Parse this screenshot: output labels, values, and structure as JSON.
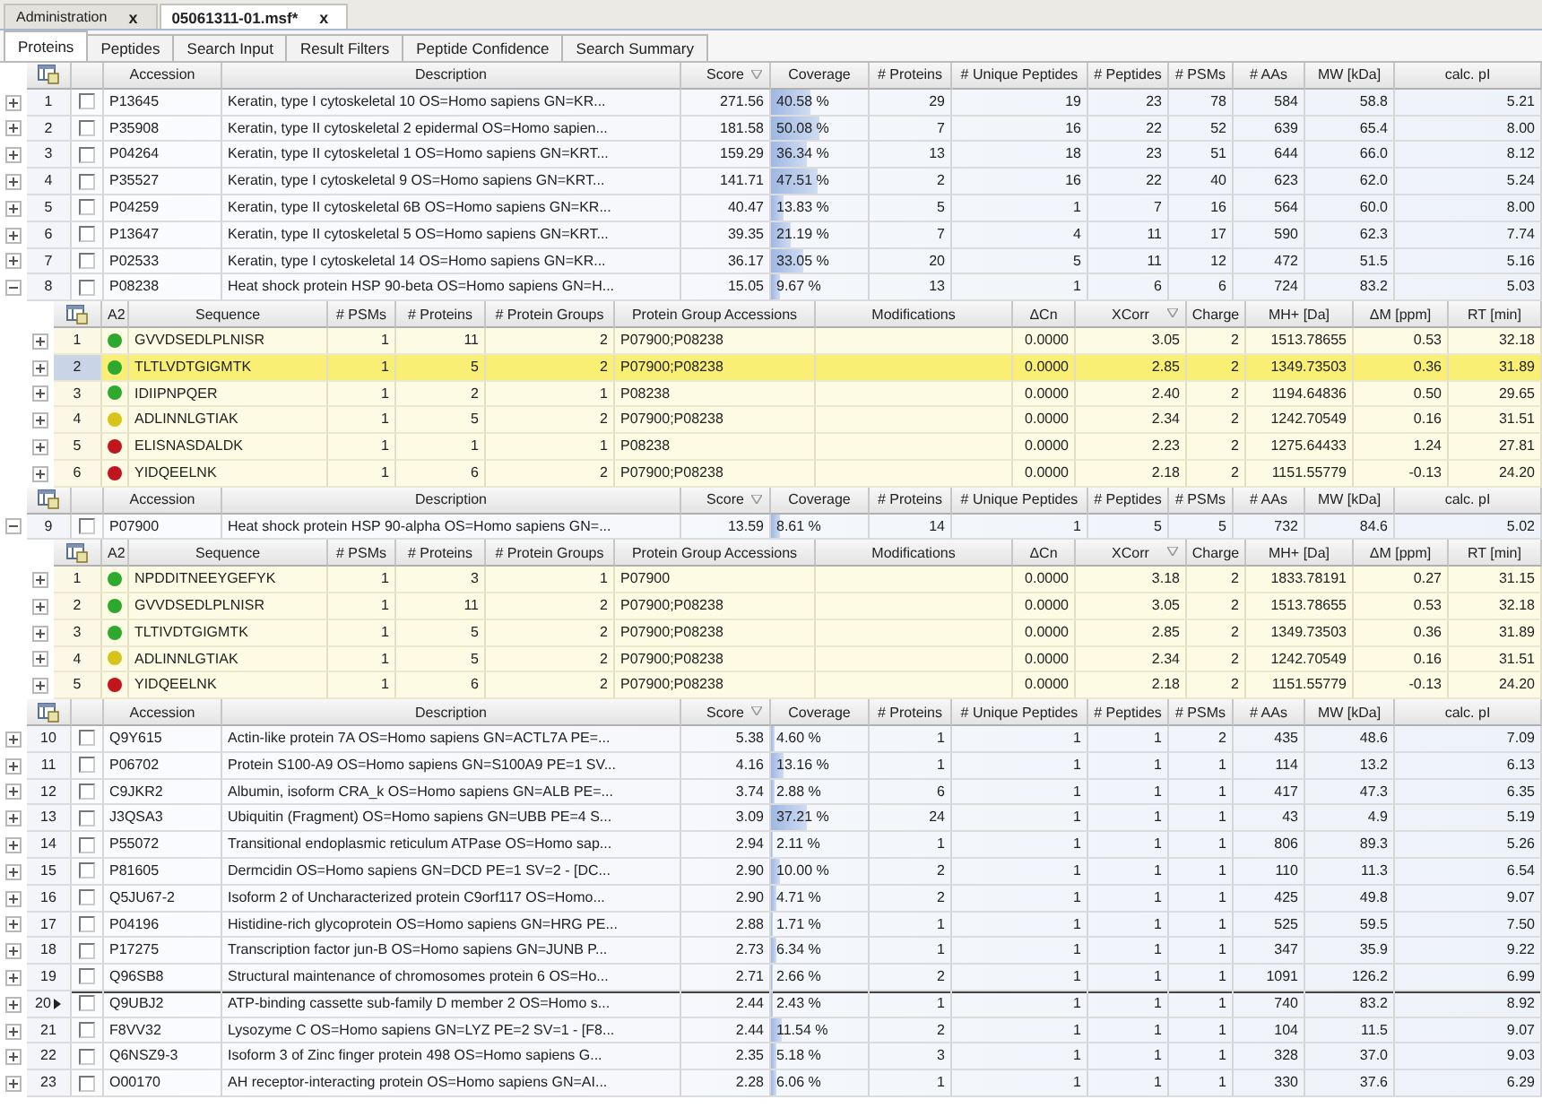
{
  "doc_tabs": [
    {
      "label": "Administration",
      "close": "x",
      "selected": false
    },
    {
      "label": "05061311-01.msf*",
      "close": "x",
      "selected": true
    }
  ],
  "view_tabs": [
    {
      "label": "Proteins",
      "selected": true
    },
    {
      "label": "Peptides",
      "selected": false
    },
    {
      "label": "Search Input",
      "selected": false
    },
    {
      "label": "Result Filters",
      "selected": false
    },
    {
      "label": "Peptide Confidence",
      "selected": false
    },
    {
      "label": "Search Summary",
      "selected": false
    }
  ],
  "sections": [
    {
      "columns": [
        {
          "label": "Accession",
          "sorted": false
        },
        {
          "label": "Description",
          "sorted": false
        },
        {
          "label": "Score",
          "sorted": true
        },
        {
          "label": "Coverage",
          "sorted": false
        },
        {
          "label": "# Proteins",
          "sorted": false
        },
        {
          "label": "# Unique Peptides",
          "sorted": false
        },
        {
          "label": "# Peptides",
          "sorted": false
        },
        {
          "label": "# PSMs",
          "sorted": false
        },
        {
          "label": "# AAs",
          "sorted": false
        },
        {
          "label": "MW [kDa]",
          "sorted": false
        },
        {
          "label": "calc. pI",
          "sorted": false
        }
      ],
      "rows": [
        {
          "n": "1",
          "expanded": false,
          "checked": false,
          "selected": false,
          "accession": "P13645",
          "description": "Keratin, type I cytoskeletal 10 OS=Homo sapiens GN=KR...",
          "score": "271.56",
          "coverage": "40.58 %",
          "level": 0.4058,
          "proteins": "29",
          "unique_peptides": "19",
          "num_peptides": "23",
          "psms": "78",
          "aas": "584",
          "mw": "58.8",
          "pi": "5.21"
        },
        {
          "n": "2",
          "expanded": false,
          "checked": false,
          "selected": false,
          "accession": "P35908",
          "description": "Keratin, type II cytoskeletal 2 epidermal OS=Homo sapien...",
          "score": "181.58",
          "coverage": "50.08 %",
          "level": 0.5008,
          "proteins": "7",
          "unique_peptides": "16",
          "num_peptides": "22",
          "psms": "52",
          "aas": "639",
          "mw": "65.4",
          "pi": "8.00"
        },
        {
          "n": "3",
          "expanded": false,
          "checked": false,
          "selected": false,
          "accession": "P04264",
          "description": "Keratin, type II cytoskeletal 1 OS=Homo sapiens GN=KRT...",
          "score": "159.29",
          "coverage": "36.34 %",
          "level": 0.3634,
          "proteins": "13",
          "unique_peptides": "18",
          "num_peptides": "23",
          "psms": "51",
          "aas": "644",
          "mw": "66.0",
          "pi": "8.12"
        },
        {
          "n": "4",
          "expanded": false,
          "checked": false,
          "selected": false,
          "accession": "P35527",
          "description": "Keratin, type I cytoskeletal 9 OS=Homo sapiens GN=KRT...",
          "score": "141.71",
          "coverage": "47.51 %",
          "level": 0.4751,
          "proteins": "2",
          "unique_peptides": "16",
          "num_peptides": "22",
          "psms": "40",
          "aas": "623",
          "mw": "62.0",
          "pi": "5.24"
        },
        {
          "n": "5",
          "expanded": false,
          "checked": false,
          "selected": false,
          "accession": "P04259",
          "description": "Keratin, type II cytoskeletal 6B OS=Homo sapiens GN=KR...",
          "score": "40.47",
          "coverage": "13.83 %",
          "level": 0.1383,
          "proteins": "5",
          "unique_peptides": "1",
          "num_peptides": "7",
          "psms": "16",
          "aas": "564",
          "mw": "60.0",
          "pi": "8.00"
        },
        {
          "n": "6",
          "expanded": false,
          "checked": false,
          "selected": false,
          "accession": "P13647",
          "description": "Keratin, type II cytoskeletal 5 OS=Homo sapiens GN=KRT...",
          "score": "39.35",
          "coverage": "21.19 %",
          "level": 0.2119,
          "proteins": "7",
          "unique_peptides": "4",
          "num_peptides": "11",
          "psms": "17",
          "aas": "590",
          "mw": "62.3",
          "pi": "7.74"
        },
        {
          "n": "7",
          "expanded": false,
          "checked": false,
          "selected": false,
          "accession": "P02533",
          "description": "Keratin, type I cytoskeletal 14 OS=Homo sapiens GN=KR...",
          "score": "36.17",
          "coverage": "33.05 %",
          "level": 0.3305,
          "proteins": "20",
          "unique_peptides": "5",
          "num_peptides": "11",
          "psms": "12",
          "aas": "472",
          "mw": "51.5",
          "pi": "5.16"
        },
        {
          "n": "8",
          "expanded": true,
          "checked": false,
          "selected": false,
          "accession": "P08238",
          "description": "Heat shock protein HSP 90-beta OS=Homo sapiens GN=H...",
          "score": "15.05",
          "coverage": "9.67 %",
          "level": 0.0967,
          "proteins": "13",
          "unique_peptides": "1",
          "num_peptides": "6",
          "psms": "6",
          "aas": "724",
          "mw": "83.2",
          "pi": "5.03",
          "peptide_table": {
            "columns": [
              {
                "label": "A2",
                "sorted": false
              },
              {
                "label": "Sequence",
                "sorted": false
              },
              {
                "label": "# PSMs",
                "sorted": false
              },
              {
                "label": "# Proteins",
                "sorted": false
              },
              {
                "label": "# Protein Groups",
                "sorted": false
              },
              {
                "label": "Protein Group Accessions",
                "sorted": false
              },
              {
                "label": "Modifications",
                "sorted": false
              },
              {
                "label": "ΔCn",
                "sorted": false
              },
              {
                "label": "XCorr",
                "sorted": true
              },
              {
                "label": "Charge",
                "sorted": false
              },
              {
                "label": "MH+ [Da]",
                "sorted": false
              },
              {
                "label": "ΔM [ppm]",
                "sorted": false
              },
              {
                "label": "RT [min]",
                "sorted": false
              }
            ],
            "rows": [
              {
                "n": "1",
                "expanded": false,
                "selected": false,
                "color": "#2ea82e",
                "sequence": "GVVDSEDLPLNISR",
                "psms": "1",
                "proteins": "11",
                "groups": "2",
                "accessions": "P07900;P08238",
                "dcn": "0.0000",
                "xcorr": "3.05",
                "charge": "2",
                "mh": "1513.78655",
                "dm": "0.53",
                "rt": "32.18"
              },
              {
                "n": "2",
                "expanded": false,
                "selected": true,
                "color": "#2ea82e",
                "sequence": "TLTLVDTGIGMTK",
                "psms": "1",
                "proteins": "5",
                "groups": "2",
                "accessions": "P07900;P08238",
                "dcn": "0.0000",
                "xcorr": "2.85",
                "charge": "2",
                "mh": "1349.73503",
                "dm": "0.36",
                "rt": "31.89"
              },
              {
                "n": "3",
                "expanded": false,
                "selected": false,
                "color": "#2ea82e",
                "sequence": "IDIIPNPQER",
                "psms": "1",
                "proteins": "2",
                "groups": "1",
                "accessions": "P08238",
                "dcn": "0.0000",
                "xcorr": "2.40",
                "charge": "2",
                "mh": "1194.64836",
                "dm": "0.50",
                "rt": "29.65"
              },
              {
                "n": "4",
                "expanded": false,
                "selected": false,
                "color": "#d8c21c",
                "sequence": "ADLINNLGTIAK",
                "psms": "1",
                "proteins": "5",
                "groups": "2",
                "accessions": "P07900;P08238",
                "dcn": "0.0000",
                "xcorr": "2.34",
                "charge": "2",
                "mh": "1242.70549",
                "dm": "0.16",
                "rt": "31.51"
              },
              {
                "n": "5",
                "expanded": false,
                "selected": false,
                "color": "#c0161e",
                "sequence": "ELISNASDALDK",
                "psms": "1",
                "proteins": "1",
                "groups": "1",
                "accessions": "P08238",
                "dcn": "0.0000",
                "xcorr": "2.23",
                "charge": "2",
                "mh": "1275.64433",
                "dm": "1.24",
                "rt": "27.81"
              },
              {
                "n": "6",
                "expanded": false,
                "selected": false,
                "color": "#c0161e",
                "sequence": "YIDQEELNK",
                "psms": "1",
                "proteins": "6",
                "groups": "2",
                "accessions": "P07900;P08238",
                "dcn": "0.0000",
                "xcorr": "2.18",
                "charge": "2",
                "mh": "1151.55779",
                "dm": "-0.13",
                "rt": "24.20"
              }
            ]
          }
        }
      ]
    },
    {
      "columns": [
        {
          "label": "Accession",
          "sorted": false
        },
        {
          "label": "Description",
          "sorted": false
        },
        {
          "label": "Score",
          "sorted": true
        },
        {
          "label": "Coverage",
          "sorted": false
        },
        {
          "label": "# Proteins",
          "sorted": false
        },
        {
          "label": "# Unique Peptides",
          "sorted": false
        },
        {
          "label": "# Peptides",
          "sorted": false
        },
        {
          "label": "# PSMs",
          "sorted": false
        },
        {
          "label": "# AAs",
          "sorted": false
        },
        {
          "label": "MW [kDa]",
          "sorted": false
        },
        {
          "label": "calc. pI",
          "sorted": false
        }
      ],
      "rows": [
        {
          "n": "9",
          "expanded": true,
          "checked": false,
          "selected": false,
          "accession": "P07900",
          "description": "Heat shock protein HSP 90-alpha OS=Homo sapiens GN=...",
          "score": "13.59",
          "coverage": "8.61 %",
          "level": 0.0861,
          "proteins": "14",
          "unique_peptides": "1",
          "num_peptides": "5",
          "psms": "5",
          "aas": "732",
          "mw": "84.6",
          "pi": "5.02",
          "peptide_table": {
            "columns": [
              {
                "label": "A2",
                "sorted": false
              },
              {
                "label": "Sequence",
                "sorted": false
              },
              {
                "label": "# PSMs",
                "sorted": false
              },
              {
                "label": "# Proteins",
                "sorted": false
              },
              {
                "label": "# Protein Groups",
                "sorted": false
              },
              {
                "label": "Protein Group Accessions",
                "sorted": false
              },
              {
                "label": "Modifications",
                "sorted": false
              },
              {
                "label": "ΔCn",
                "sorted": false
              },
              {
                "label": "XCorr",
                "sorted": true
              },
              {
                "label": "Charge",
                "sorted": false
              },
              {
                "label": "MH+ [Da]",
                "sorted": false
              },
              {
                "label": "ΔM [ppm]",
                "sorted": false
              },
              {
                "label": "RT [min]",
                "sorted": false
              }
            ],
            "rows": [
              {
                "n": "1",
                "expanded": false,
                "selected": false,
                "color": "#2ea82e",
                "sequence": "NPDDITNEEYGEFYK",
                "psms": "1",
                "proteins": "3",
                "groups": "1",
                "accessions": "P07900",
                "dcn": "0.0000",
                "xcorr": "3.18",
                "charge": "2",
                "mh": "1833.78191",
                "dm": "0.27",
                "rt": "31.15"
              },
              {
                "n": "2",
                "expanded": false,
                "selected": false,
                "color": "#2ea82e",
                "sequence": "GVVDSEDLPLNISR",
                "psms": "1",
                "proteins": "11",
                "groups": "2",
                "accessions": "P07900;P08238",
                "dcn": "0.0000",
                "xcorr": "3.05",
                "charge": "2",
                "mh": "1513.78655",
                "dm": "0.53",
                "rt": "32.18"
              },
              {
                "n": "3",
                "expanded": false,
                "selected": false,
                "color": "#2ea82e",
                "sequence": "TLTIVDTGIGMTK",
                "psms": "1",
                "proteins": "5",
                "groups": "2",
                "accessions": "P07900;P08238",
                "dcn": "0.0000",
                "xcorr": "2.85",
                "charge": "2",
                "mh": "1349.73503",
                "dm": "0.36",
                "rt": "31.89"
              },
              {
                "n": "4",
                "expanded": false,
                "selected": false,
                "color": "#d8c21c",
                "sequence": "ADLINNLGTIAK",
                "psms": "1",
                "proteins": "5",
                "groups": "2",
                "accessions": "P07900;P08238",
                "dcn": "0.0000",
                "xcorr": "2.34",
                "charge": "2",
                "mh": "1242.70549",
                "dm": "0.16",
                "rt": "31.51"
              },
              {
                "n": "5",
                "expanded": false,
                "selected": false,
                "color": "#c0161e",
                "sequence": "YIDQEELNK",
                "psms": "1",
                "proteins": "6",
                "groups": "2",
                "accessions": "P07900;P08238",
                "dcn": "0.0000",
                "xcorr": "2.18",
                "charge": "2",
                "mh": "1151.55779",
                "dm": "-0.13",
                "rt": "24.20"
              }
            ]
          }
        }
      ]
    },
    {
      "columns": [
        {
          "label": "Accession",
          "sorted": false
        },
        {
          "label": "Description",
          "sorted": false
        },
        {
          "label": "Score",
          "sorted": true
        },
        {
          "label": "Coverage",
          "sorted": false
        },
        {
          "label": "# Proteins",
          "sorted": false
        },
        {
          "label": "# Unique Peptides",
          "sorted": false
        },
        {
          "label": "# Peptides",
          "sorted": false
        },
        {
          "label": "# PSMs",
          "sorted": false
        },
        {
          "label": "# AAs",
          "sorted": false
        },
        {
          "label": "MW [kDa]",
          "sorted": false
        },
        {
          "label": "calc. pI",
          "sorted": false
        }
      ],
      "rows": [
        {
          "n": "10",
          "expanded": false,
          "checked": false,
          "selected": false,
          "accession": "Q9Y615",
          "description": "Actin-like protein 7A OS=Homo sapiens GN=ACTL7A PE=...",
          "score": "5.38",
          "coverage": "4.60 %",
          "level": 0.046,
          "proteins": "1",
          "unique_peptides": "1",
          "num_peptides": "1",
          "psms": "2",
          "aas": "435",
          "mw": "48.6",
          "pi": "7.09"
        },
        {
          "n": "11",
          "expanded": false,
          "checked": false,
          "selected": false,
          "accession": "P06702",
          "description": "Protein S100-A9 OS=Homo sapiens GN=S100A9 PE=1 SV...",
          "score": "4.16",
          "coverage": "13.16 %",
          "level": 0.1316,
          "proteins": "1",
          "unique_peptides": "1",
          "num_peptides": "1",
          "psms": "1",
          "aas": "114",
          "mw": "13.2",
          "pi": "6.13"
        },
        {
          "n": "12",
          "expanded": false,
          "checked": false,
          "selected": false,
          "accession": "C9JKR2",
          "description": "Albumin, isoform CRA_k OS=Homo sapiens GN=ALB PE=...",
          "score": "3.74",
          "coverage": "2.88 %",
          "level": 0.0288,
          "proteins": "6",
          "unique_peptides": "1",
          "num_peptides": "1",
          "psms": "1",
          "aas": "417",
          "mw": "47.3",
          "pi": "6.35"
        },
        {
          "n": "13",
          "expanded": false,
          "checked": false,
          "selected": false,
          "accession": "J3QSA3",
          "description": "Ubiquitin (Fragment) OS=Homo sapiens GN=UBB PE=4 S...",
          "score": "3.09",
          "coverage": "37.21 %",
          "level": 0.3721,
          "proteins": "24",
          "unique_peptides": "1",
          "num_peptides": "1",
          "psms": "1",
          "aas": "43",
          "mw": "4.9",
          "pi": "5.19"
        },
        {
          "n": "14",
          "expanded": false,
          "checked": false,
          "selected": false,
          "accession": "P55072",
          "description": "Transitional endoplasmic reticulum ATPase OS=Homo sap...",
          "score": "2.94",
          "coverage": "2.11 %",
          "level": 0.0211,
          "proteins": "1",
          "unique_peptides": "1",
          "num_peptides": "1",
          "psms": "1",
          "aas": "806",
          "mw": "89.3",
          "pi": "5.26"
        },
        {
          "n": "15",
          "expanded": false,
          "checked": false,
          "selected": false,
          "accession": "P81605",
          "description": "Dermcidin OS=Homo sapiens GN=DCD PE=1 SV=2 - [DC...",
          "score": "2.90",
          "coverage": "10.00 %",
          "level": 0.1,
          "proteins": "2",
          "unique_peptides": "1",
          "num_peptides": "1",
          "psms": "1",
          "aas": "110",
          "mw": "11.3",
          "pi": "6.54"
        },
        {
          "n": "16",
          "expanded": false,
          "checked": false,
          "selected": false,
          "accession": "Q5JU67-2",
          "description": "Isoform 2 of Uncharacterized protein C9orf117 OS=Homo...",
          "score": "2.90",
          "coverage": "4.71 %",
          "level": 0.0471,
          "proteins": "2",
          "unique_peptides": "1",
          "num_peptides": "1",
          "psms": "1",
          "aas": "425",
          "mw": "49.8",
          "pi": "9.07"
        },
        {
          "n": "17",
          "expanded": false,
          "checked": false,
          "selected": false,
          "accession": "P04196",
          "description": "Histidine-rich glycoprotein OS=Homo sapiens GN=HRG PE...",
          "score": "2.88",
          "coverage": "1.71 %",
          "level": 0.0171,
          "proteins": "1",
          "unique_peptides": "1",
          "num_peptides": "1",
          "psms": "1",
          "aas": "525",
          "mw": "59.5",
          "pi": "7.50"
        },
        {
          "n": "18",
          "expanded": false,
          "checked": false,
          "selected": false,
          "accession": "P17275",
          "description": "Transcription factor jun-B OS=Homo sapiens GN=JUNB P...",
          "score": "2.73",
          "coverage": "6.34 %",
          "level": 0.0634,
          "proteins": "1",
          "unique_peptides": "1",
          "num_peptides": "1",
          "psms": "1",
          "aas": "347",
          "mw": "35.9",
          "pi": "9.22"
        },
        {
          "n": "19",
          "expanded": false,
          "checked": false,
          "selected": false,
          "accession": "Q96SB8",
          "description": "Structural maintenance of chromosomes protein 6 OS=Ho...",
          "score": "2.71",
          "coverage": "2.66 %",
          "level": 0.0266,
          "proteins": "2",
          "unique_peptides": "1",
          "num_peptides": "1",
          "psms": "1",
          "aas": "1091",
          "mw": "126.2",
          "pi": "6.99"
        },
        {
          "n": "20",
          "expanded": false,
          "checked": false,
          "selected": true,
          "accession": "Q9UBJ2",
          "description": "ATP-binding cassette sub-family D member 2 OS=Homo s...",
          "score": "2.44",
          "coverage": "2.43 %",
          "level": 0.0243,
          "proteins": "1",
          "unique_peptides": "1",
          "num_peptides": "1",
          "psms": "1",
          "aas": "740",
          "mw": "83.2",
          "pi": "8.92"
        },
        {
          "n": "21",
          "expanded": false,
          "checked": false,
          "selected": false,
          "accession": "F8VV32",
          "description": "Lysozyme C OS=Homo sapiens GN=LYZ PE=2 SV=1 - [F8...",
          "score": "2.44",
          "coverage": "11.54 %",
          "level": 0.1154,
          "proteins": "2",
          "unique_peptides": "1",
          "num_peptides": "1",
          "psms": "1",
          "aas": "104",
          "mw": "11.5",
          "pi": "9.07"
        },
        {
          "n": "22",
          "expanded": false,
          "checked": false,
          "selected": false,
          "accession": "Q6NSZ9-3",
          "description": "Isoform 3 of Zinc finger protein 498 OS=Homo sapiens G...",
          "score": "2.35",
          "coverage": "5.18 %",
          "level": 0.0518,
          "proteins": "3",
          "unique_peptides": "1",
          "num_peptides": "1",
          "psms": "1",
          "aas": "328",
          "mw": "37.0",
          "pi": "9.03"
        },
        {
          "n": "23",
          "expanded": false,
          "checked": false,
          "selected": false,
          "accession": "O00170",
          "description": "AH receptor-interacting protein OS=Homo sapiens GN=AI...",
          "score": "2.28",
          "coverage": "6.06 %",
          "level": 0.0606,
          "proteins": "1",
          "unique_peptides": "1",
          "num_peptides": "1",
          "psms": "1",
          "aas": "330",
          "mw": "37.6",
          "pi": "6.29"
        }
      ]
    }
  ]
}
